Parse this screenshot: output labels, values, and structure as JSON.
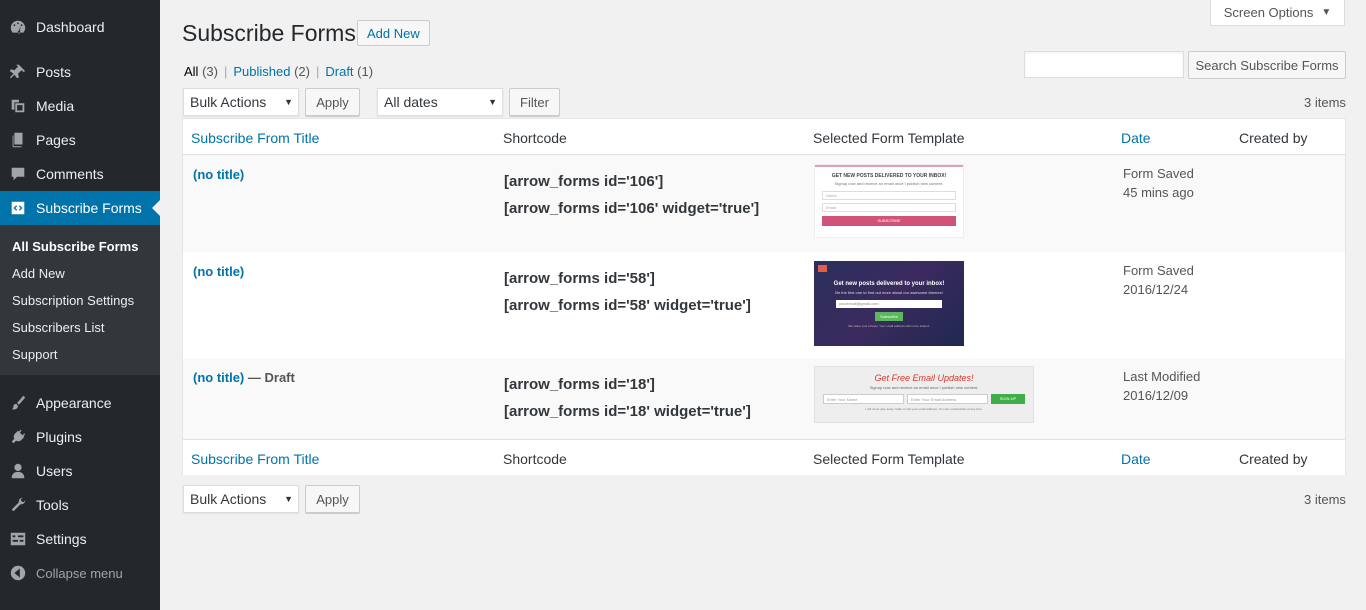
{
  "sidebar": {
    "items": [
      {
        "label": "Dashboard",
        "icon": "dashboard-icon"
      },
      {
        "label": "Posts",
        "icon": "pin-icon"
      },
      {
        "label": "Media",
        "icon": "media-icon"
      },
      {
        "label": "Pages",
        "icon": "pages-icon"
      },
      {
        "label": "Comments",
        "icon": "comment-icon"
      },
      {
        "label": "Subscribe Forms",
        "icon": "code-icon"
      },
      {
        "label": "Appearance",
        "icon": "brush-icon"
      },
      {
        "label": "Plugins",
        "icon": "plug-icon"
      },
      {
        "label": "Users",
        "icon": "user-icon"
      },
      {
        "label": "Tools",
        "icon": "wrench-icon"
      },
      {
        "label": "Settings",
        "icon": "settings-icon"
      },
      {
        "label": "Collapse menu",
        "icon": "collapse-icon"
      }
    ],
    "submenu": [
      "All Subscribe Forms",
      "Add New",
      "Subscription Settings",
      "Subscribers List",
      "Support"
    ]
  },
  "header": {
    "screen_options": "Screen Options",
    "title": "Subscribe Forms",
    "add_new": "Add New"
  },
  "filters": {
    "all": "All",
    "all_count": "(3)",
    "published": "Published",
    "published_count": "(2)",
    "draft": "Draft",
    "draft_count": "(1)",
    "sep": "|"
  },
  "search": {
    "button": "Search Subscribe Forms",
    "value": ""
  },
  "toolbar": {
    "bulk_actions": "Bulk Actions",
    "apply": "Apply",
    "all_dates": "All dates",
    "filter": "Filter",
    "items": "3 items"
  },
  "table": {
    "columns": [
      "Subscribe From Title",
      "Shortcode",
      "Selected Form Template",
      "Date",
      "Created by"
    ],
    "rows": [
      {
        "title": "(no title)",
        "state": "",
        "shortcode1": "[arrow_forms id='106']",
        "shortcode2": "[arrow_forms id='106' widget='true']",
        "date_status": "Form Saved",
        "date_value": "45 mins ago",
        "template": {
          "heading": "GET NEW POSTS DELIVERED TO YOUR INBOX!",
          "sub": "Signup now and receive an email once I publish new content.",
          "field1": "Name",
          "field2": "Email",
          "button": "SUBSCRIBE"
        }
      },
      {
        "title": "(no title)",
        "state": "",
        "shortcode1": "[arrow_forms id='58']",
        "shortcode2": "[arrow_forms id='58' widget='true']",
        "date_status": "Form Saved",
        "date_value": "2016/12/24",
        "template": {
          "heading": "Get new posts delivered to your inbox!",
          "sub": "Be the first one to find out more about our awesome themes!",
          "field1": "youremail@gmail.com",
          "button": "Subscribe",
          "footnote": "We value your privacy. Your email address will not be shared."
        }
      },
      {
        "title": "(no title)",
        "state": "— Draft",
        "shortcode1": "[arrow_forms id='18']",
        "shortcode2": "[arrow_forms id='18' widget='true']",
        "date_status": "Last Modified",
        "date_value": "2016/12/09",
        "template": {
          "heading": "Get Free Email Updates!",
          "sub": "Signup now and receive an email once I publish new content.",
          "field1": "Enter Your Name",
          "field2": "Enter Your Email Address",
          "button": "SIGN UP",
          "footnote": "I will never give away, trade or sell your email address. You can unsubscribe at any time."
        }
      }
    ]
  },
  "colors": {
    "sidebar_bg": "#23282d",
    "submenu_bg": "#32373c",
    "accent": "#0073aa",
    "link": "#0073aa"
  }
}
